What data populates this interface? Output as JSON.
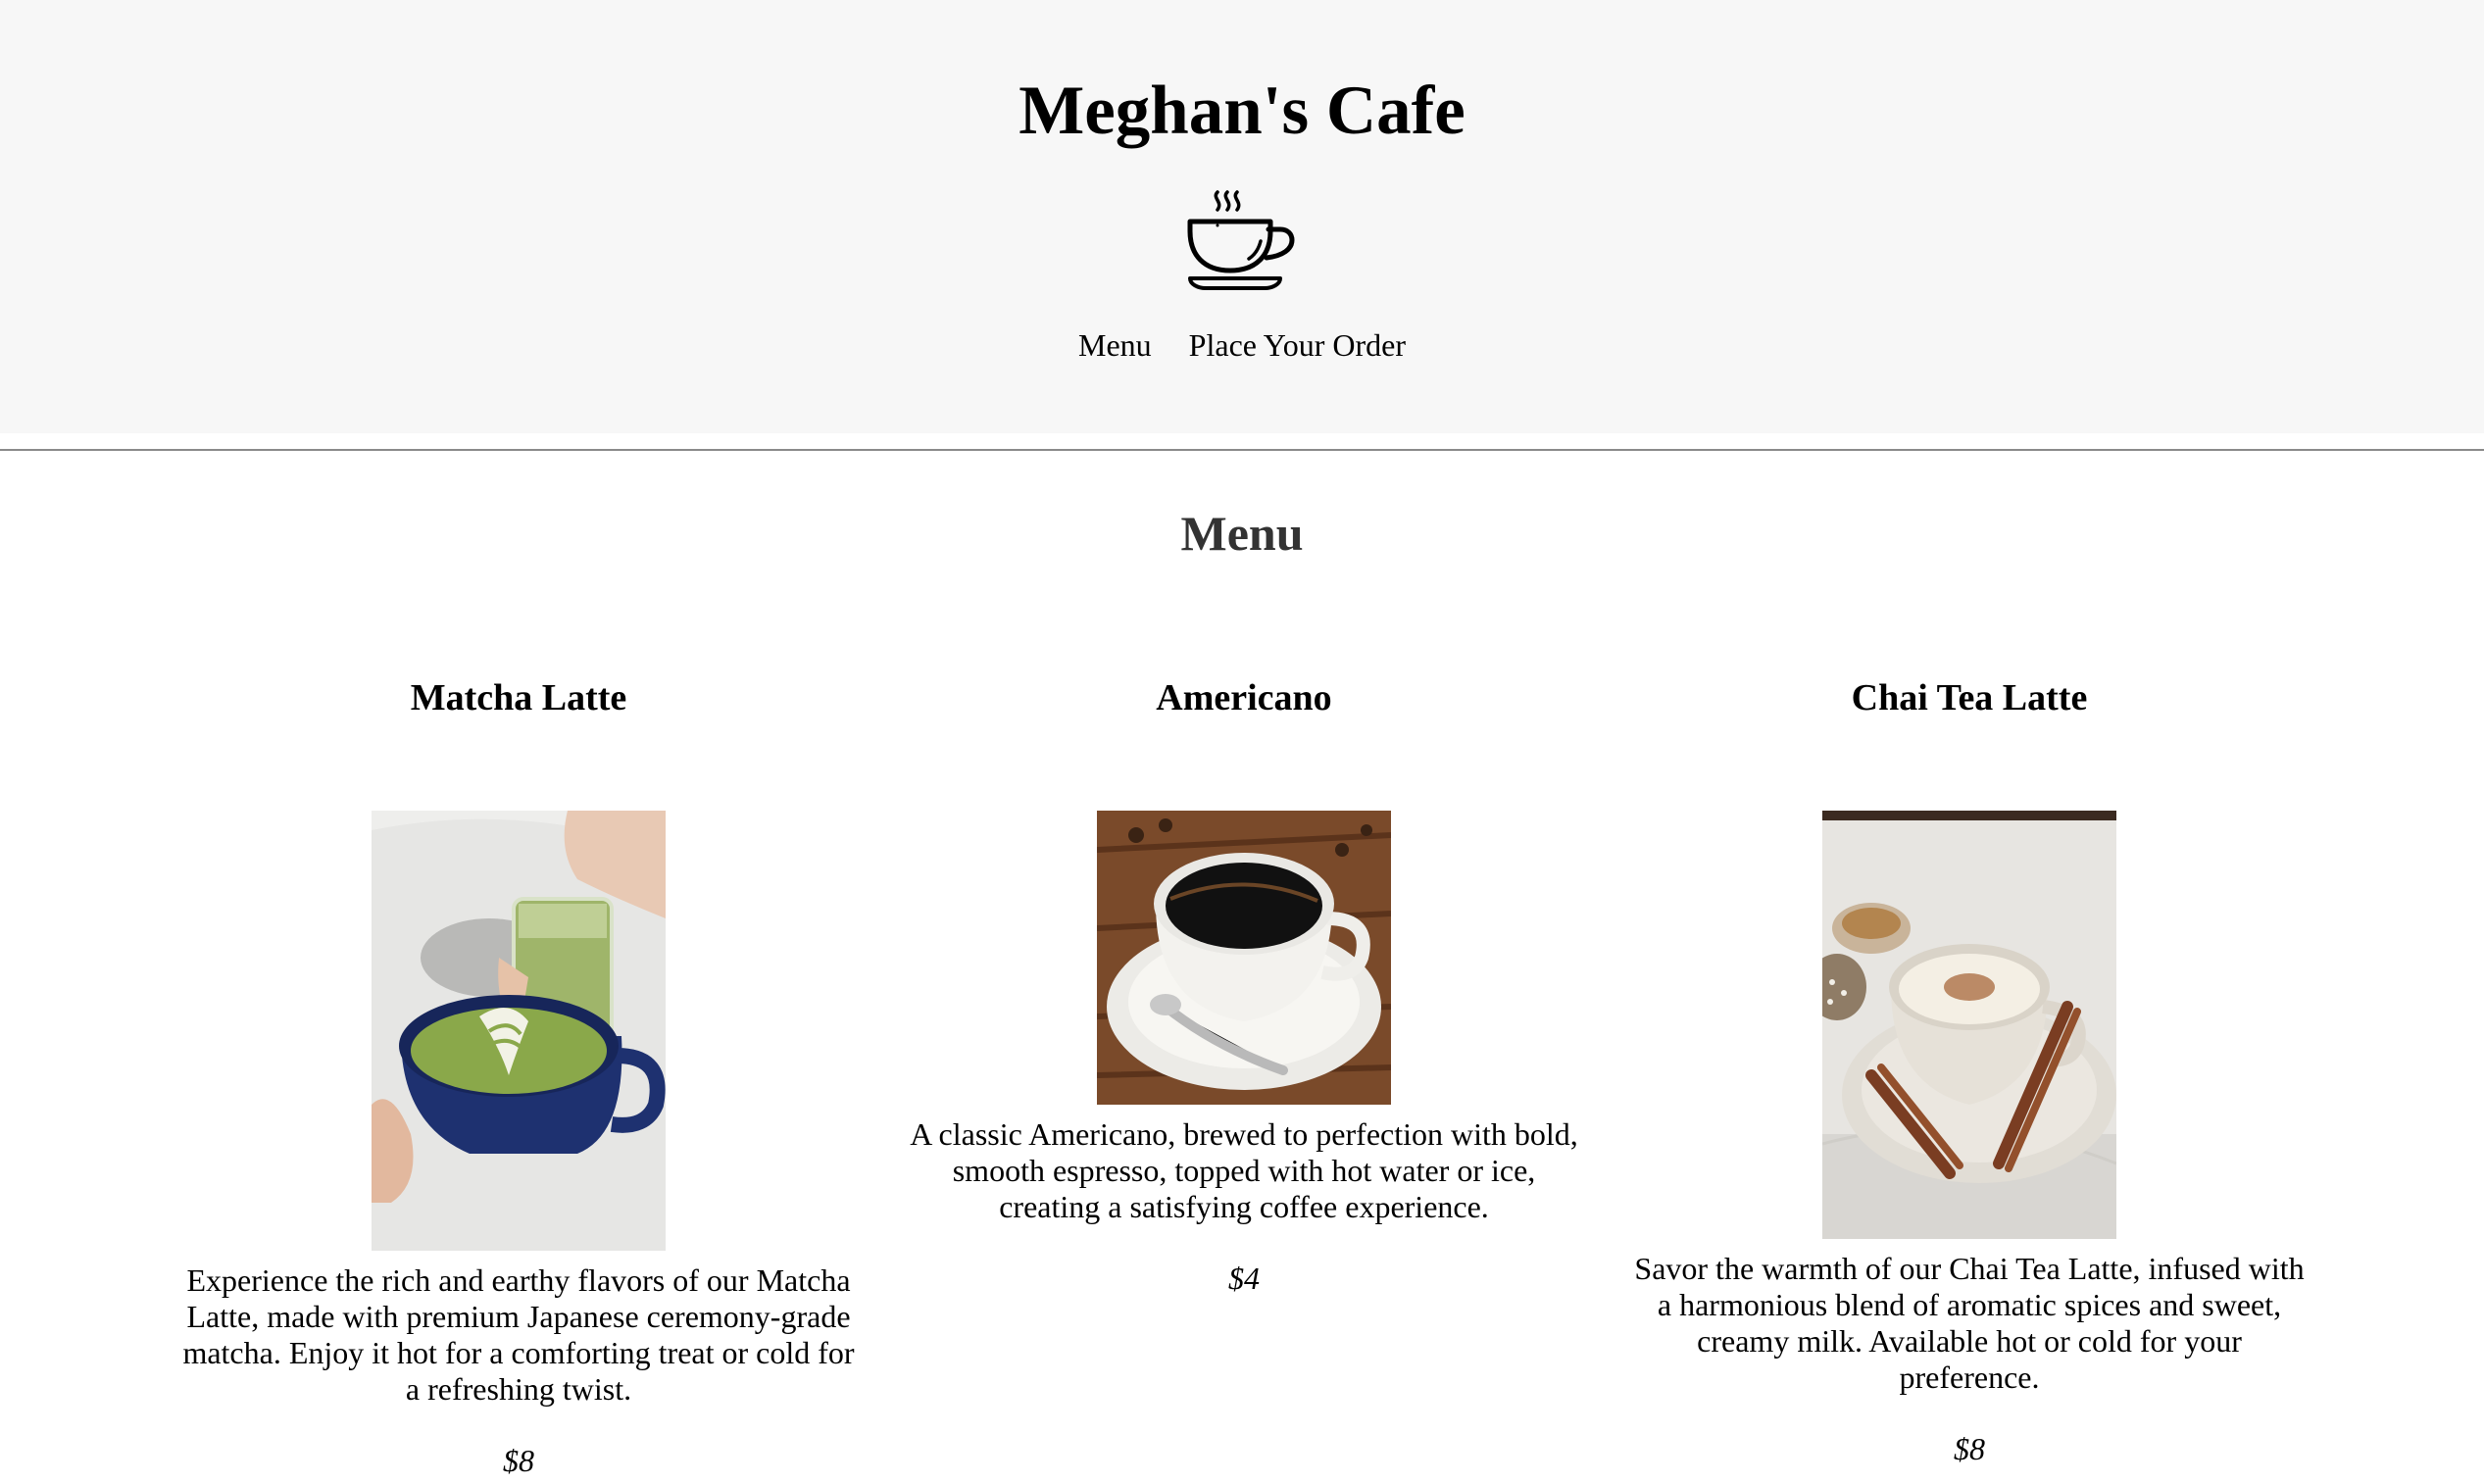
{
  "header": {
    "title": "Meghan's Cafe",
    "logo_icon": "coffee-cup-icon",
    "nav": {
      "menu_label": "Menu",
      "order_label": "Place Your Order"
    }
  },
  "menu": {
    "heading": "Menu",
    "items": [
      {
        "name": "Matcha Latte",
        "image": "matcha-latte-photo",
        "description": "Experience the rich and earthy flavors of our Matcha Latte, made with premium Japanese ceremony-grade matcha. Enjoy it hot for a comforting treat or cold for a refreshing twist.",
        "price": "$8"
      },
      {
        "name": "Americano",
        "image": "americano-photo",
        "description": "A classic Americano, brewed to perfection with bold, smooth espresso, topped with hot water or ice, creating a satisfying coffee experience.",
        "price": "$4"
      },
      {
        "name": "Chai Tea Latte",
        "image": "chai-tea-latte-photo",
        "description": "Savor the warmth of our Chai Tea Latte, infused with a harmonious blend of aromatic spices and sweet, creamy milk. Available hot or cold for your preference.",
        "price": "$8"
      }
    ]
  },
  "colors": {
    "header_bg": "#f7f7f7",
    "divider": "#8a8a8a",
    "menu_heading": "#333333",
    "matcha_green": "#8aa84a",
    "matcha_cup": "#1e3170",
    "wood": "#7a4a2a"
  }
}
